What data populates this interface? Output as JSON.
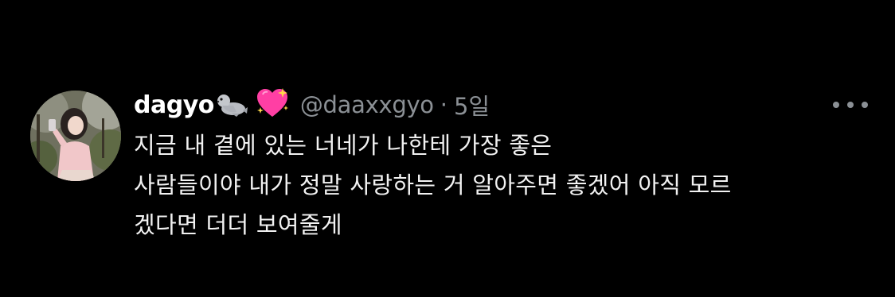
{
  "tweet": {
    "display_name": "dagyo",
    "name_emojis": [
      "seal-emoji",
      "sparkling-heart-emoji"
    ],
    "handle": "@daaxxgyo",
    "separator": "·",
    "time": "5일",
    "text_lines": [
      "지금 내 곁에 있는 너네가 나한테 가장 좋은",
      "사람들이야 내가 정말 사랑하는 거 알아주면 좋겠어 아직 모르",
      "겠다면 더더 보여줄게"
    ],
    "more_icon": "more-horizontal-icon"
  },
  "colors": {
    "background": "#000000",
    "name": "#ffffff",
    "secondary": "#8b9095",
    "text": "#f2f2f2",
    "heart": "#ff3fa4"
  }
}
